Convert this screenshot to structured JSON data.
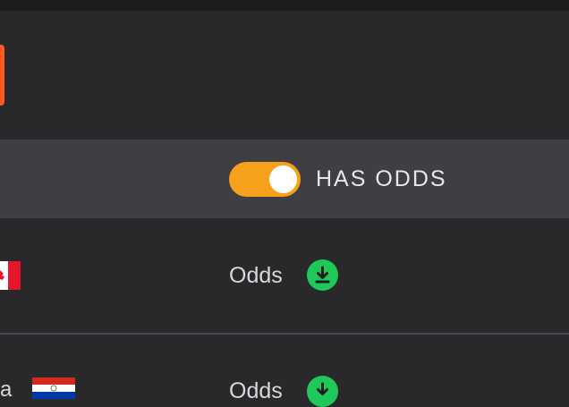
{
  "filter": {
    "toggle_label": "HAS ODDS",
    "toggle_on": true
  },
  "rows": [
    {
      "odds_label": "Odds",
      "flag": "canada-flag"
    },
    {
      "team_fragment": "a",
      "odds_label": "Odds",
      "flag": "paraguay-flag"
    }
  ],
  "colors": {
    "accent": "#f7a01c",
    "download": "#1ec95a",
    "brand": "#ff5a1f"
  }
}
